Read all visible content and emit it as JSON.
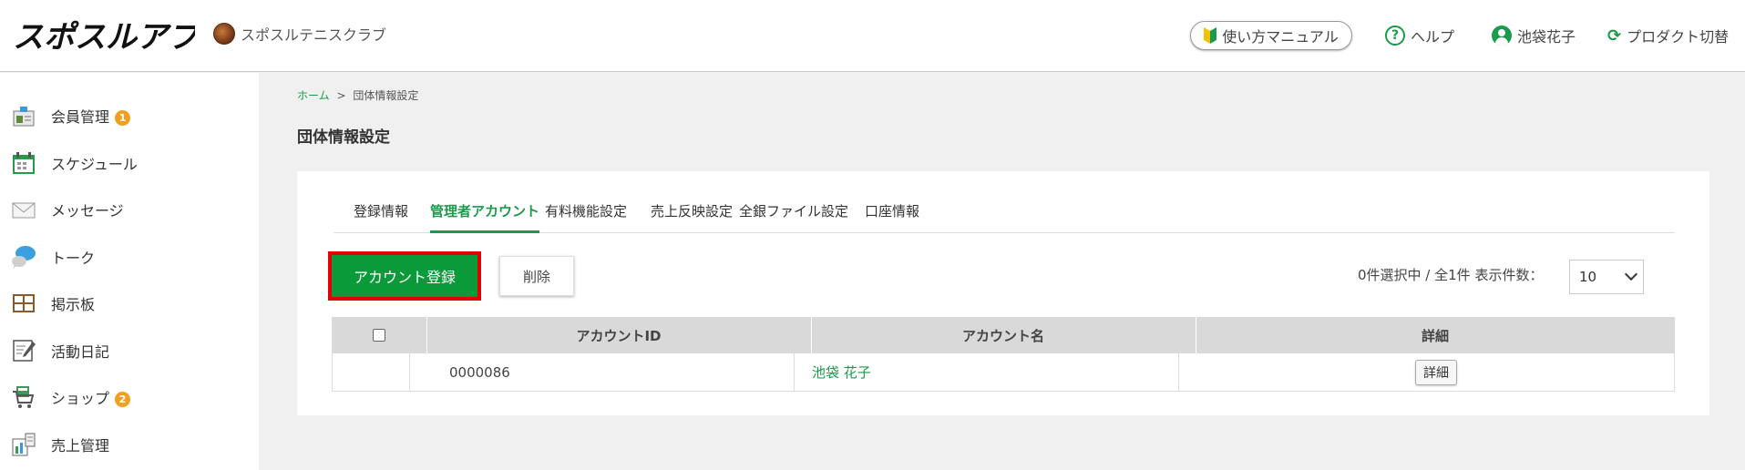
{
  "header": {
    "logo_text": "スポスルアプリ",
    "club_name": "スポスルテニスクラブ",
    "manual_label": "使い方マニュアル",
    "help_label": "ヘルプ",
    "user_name": "池袋花子",
    "switch_label": "プロダクト切替"
  },
  "sidebar": {
    "items": [
      {
        "label": "会員管理",
        "badge": "1",
        "icon": "member-card-icon"
      },
      {
        "label": "スケジュール",
        "icon": "calendar-icon"
      },
      {
        "label": "メッセージ",
        "icon": "envelope-icon"
      },
      {
        "label": "トーク",
        "icon": "chat-bubble-icon"
      },
      {
        "label": "掲示板",
        "icon": "bulletin-board-icon"
      },
      {
        "label": "活動日記",
        "icon": "diary-icon"
      },
      {
        "label": "ショップ",
        "badge": "2",
        "icon": "shop-cart-icon"
      },
      {
        "label": "売上管理",
        "icon": "sales-report-icon"
      }
    ]
  },
  "breadcrumb": {
    "home": "ホーム",
    "separator": ">",
    "current": "団体情報設定"
  },
  "page_title": "団体情報設定",
  "tabs": [
    {
      "label": "登録情報"
    },
    {
      "label": "管理者アカウント",
      "active": true
    },
    {
      "label": "有料機能設定"
    },
    {
      "label": "売上反映設定"
    },
    {
      "label": "全銀ファイル設定"
    },
    {
      "label": "口座情報"
    }
  ],
  "actions": {
    "register_label": "アカウント登録",
    "delete_label": "削除"
  },
  "pagination": {
    "count_text": "0件選択中 / 全1件 表示件数：",
    "per_page": "10"
  },
  "table": {
    "headers": [
      "アカウントID",
      "アカウント名",
      "詳細"
    ],
    "rows": [
      {
        "id": "0000086",
        "name": "池袋 花子",
        "detail_label": "詳細"
      }
    ]
  },
  "colors": {
    "brand_green": "#1a9a4a",
    "register_bg": "#0a9a3a",
    "highlight_border": "#e30000",
    "badge": "#f0a020"
  }
}
